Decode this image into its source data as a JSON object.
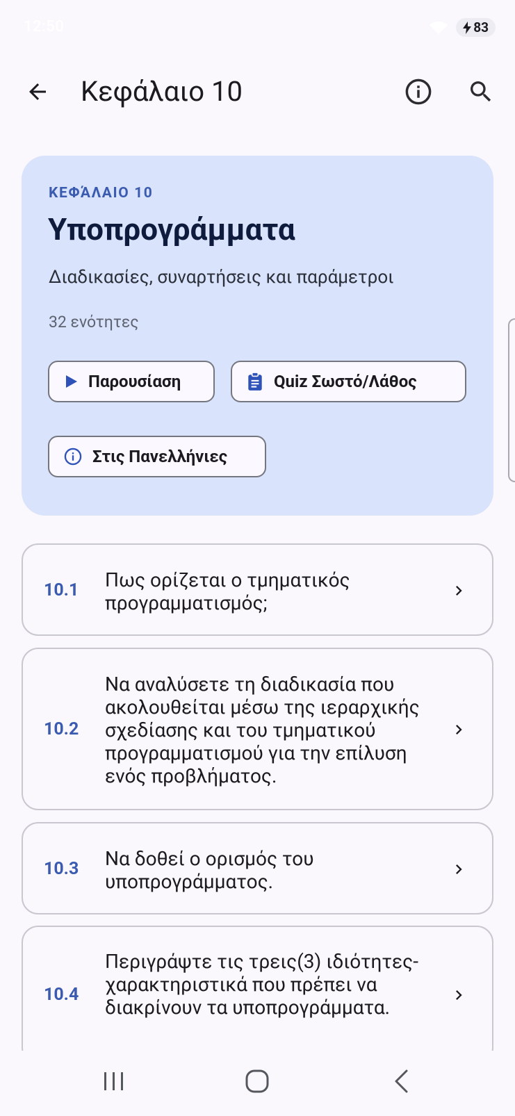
{
  "status": {
    "time": "12:50",
    "battery": "83"
  },
  "topbar": {
    "title": "Κεφάλαιο 10"
  },
  "hero": {
    "kicker": "ΚΕΦΆΛΑΙΟ 10",
    "title": "Υποπρογράμματα",
    "subtitle": "Διαδικασίες, συναρτήσεις και παράμετροι",
    "count": "32 ενότητες",
    "buttons": {
      "presentation": "Παρουσίαση",
      "quiz": "Quiz Σωστό/Λάθος",
      "panellinies": "Στις Πανελλήνιες"
    }
  },
  "sections": [
    {
      "num": "10.1",
      "text": "Πως ορίζεται ο τμηματικός προγραμματισμός;"
    },
    {
      "num": "10.2",
      "text": "Να αναλύσετε τη διαδικασία που ακολουθείται μέσω της ιεραρχικής σχεδίασης και του τμηματικού προγραμματισμού για την επίλυση ενός προβλήματος."
    },
    {
      "num": "10.3",
      "text": "Να δοθεί ο ορισμός του υποπρογράμματος."
    },
    {
      "num": "10.4",
      "text": "Περιγράψτε τις τρεις(3) ιδιότητες-χαρακτηριστικά που πρέπει να διακρίνουν τα υποπρογράμματα."
    }
  ],
  "colors": {
    "accent": "#3a5bb0",
    "hero_bg": "#d9e3fb",
    "page_bg": "#fbf8fd"
  }
}
